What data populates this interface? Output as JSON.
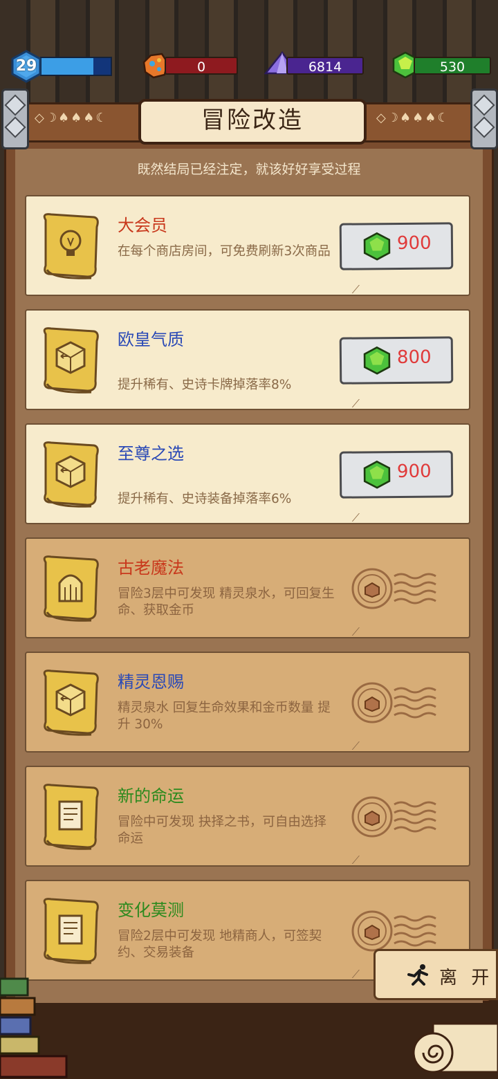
{
  "resources": {
    "level": "29",
    "level_progress": 0.75,
    "ore": "0",
    "crystal": "6814",
    "gem": "530",
    "colors": {
      "ore_bar": "#8e1a1f",
      "crystal_bar": "#4a2590",
      "gem_bar": "#1f7f2b",
      "xp_fill": "#3c9ee6"
    }
  },
  "header": {
    "title": "冒险改造",
    "subtitle": "既然结局已经注定，就该好好享受过程"
  },
  "cards": [
    {
      "name": "大会员",
      "desc": "在每个商店房间，可免费刷新3次商品",
      "price": "900",
      "icon": "lightbulb-icon",
      "state": "purchasable"
    },
    {
      "name": "欧皇气质",
      "desc": "提升稀有、史诗卡牌掉落率8%",
      "price": "800",
      "icon": "dice-icon",
      "state": "purchasable"
    },
    {
      "name": "至尊之选",
      "desc": "提升稀有、史诗装备掉落率6%",
      "price": "900",
      "icon": "dice-icon",
      "state": "purchasable"
    },
    {
      "name": "古老魔法",
      "desc": "冒险3层中可发现 精灵泉水，可回复生命、获取金币",
      "icon": "fountain-icon",
      "state": "owned"
    },
    {
      "name": "精灵恩赐",
      "desc": "精灵泉水 回复生命效果和金币数量 提升 30%",
      "icon": "dice-icon",
      "state": "owned"
    },
    {
      "name": "新的命运",
      "desc": "冒险中可发现 抉择之书，可自由选择命运",
      "icon": "book-icon",
      "state": "owned"
    },
    {
      "name": "变化莫测",
      "desc": "冒险2层中可发现 地精商人，可签契约、交易装备",
      "icon": "book-icon",
      "state": "owned"
    }
  ],
  "footer": {
    "leave_label": "离 开"
  }
}
